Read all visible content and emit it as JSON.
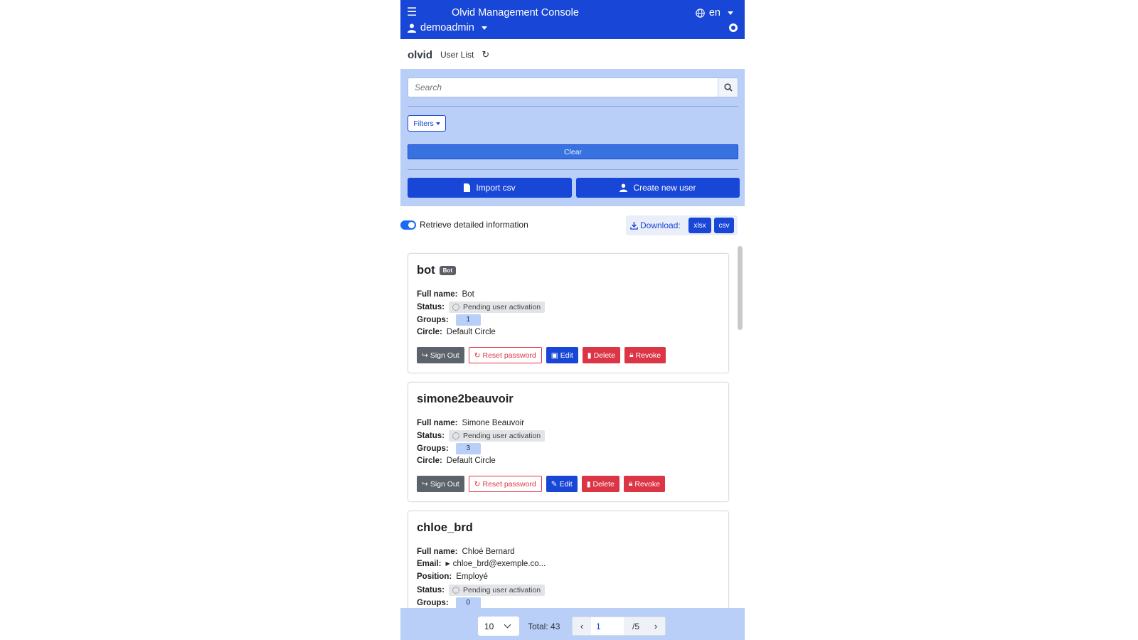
{
  "header": {
    "title": "Olvid Management Console",
    "language": "en",
    "username": "demoadmin"
  },
  "breadcrumb": {
    "brand": "olvid",
    "page": "User List"
  },
  "search": {
    "placeholder": "Search",
    "filters_label": "Filters",
    "clear_label": "Clear",
    "import_label": "Import csv",
    "create_label": "Create new user"
  },
  "options": {
    "detailed_info_label": "Retrieve detailed information",
    "detailed_info_enabled": true,
    "download_label": "Download:",
    "xlsx_label": "xlsx",
    "csv_label": "csv"
  },
  "labels": {
    "full_name": "Full name:",
    "status": "Status:",
    "groups": "Groups:",
    "circle": "Circle:",
    "email": "Email:",
    "position": "Position:"
  },
  "actions": {
    "sign_out": "Sign Out",
    "reset_password": "Reset password",
    "edit": "Edit",
    "delete": "Delete",
    "revoke": "Revoke"
  },
  "users": [
    {
      "username": "bot",
      "badge": "Bot",
      "full_name": "Bot",
      "status": "Pending user activation",
      "groups": "1",
      "circle": "Default Circle"
    },
    {
      "username": "simone2beauvoir",
      "full_name": "Simone Beauvoir",
      "status": "Pending user activation",
      "groups": "3",
      "circle": "Default Circle"
    },
    {
      "username": "chloe_brd",
      "full_name": "Chloé Bernard",
      "email": "chloe_brd@exemple.co...",
      "position": "Employé",
      "status": "Pending user activation",
      "groups": "0"
    }
  ],
  "pagination": {
    "page_size": "10",
    "total": "Total: 43",
    "current_page": "1",
    "total_pages": "/5"
  },
  "colors": {
    "primary": "#1846d6",
    "panel": "#b9cff7",
    "danger": "#dc3545",
    "secondary": "#5c636a"
  }
}
